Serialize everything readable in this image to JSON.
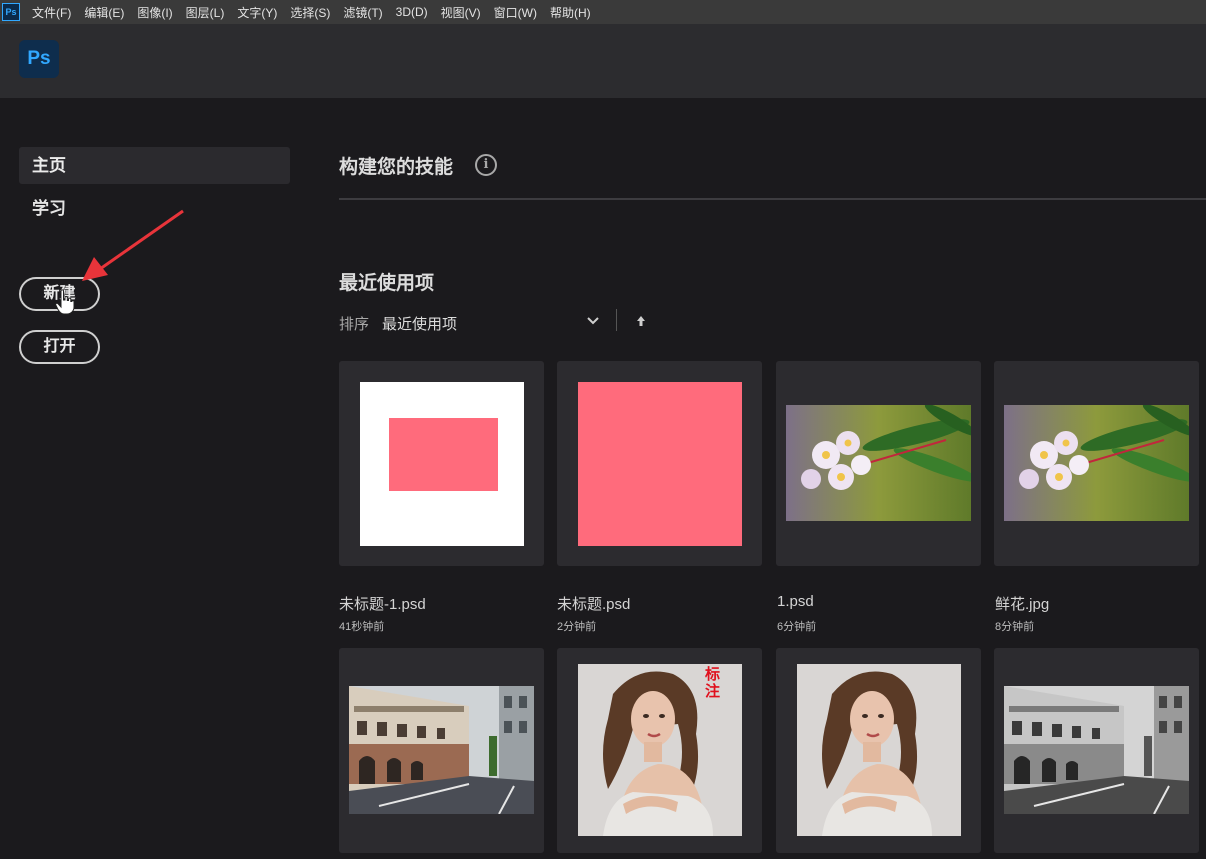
{
  "menu": [
    "文件(F)",
    "编辑(E)",
    "图像(I)",
    "图层(L)",
    "文字(Y)",
    "选择(S)",
    "滤镜(T)",
    "3D(D)",
    "视图(V)",
    "窗口(W)",
    "帮助(H)"
  ],
  "app": {
    "menu_icon": "Ps",
    "logo": "Ps",
    "brand_color": "#31a8ff"
  },
  "sidebar": {
    "home": "主页",
    "learn": "学习",
    "new_button": "新建",
    "open_button": "打开"
  },
  "main": {
    "skills_title": "构建您的技能",
    "info_icon": "i",
    "recent_title": "最近使用项",
    "sort_label": "排序",
    "sort_value": "最近使用项"
  },
  "files": [
    {
      "name": "未标题-1.psd",
      "time": "41秒钟前",
      "thumb": "white-with-pink-rect"
    },
    {
      "name": "未标题.psd",
      "time": "2分钟前",
      "thumb": "solid-pink"
    },
    {
      "name": "1.psd",
      "time": "6分钟前",
      "thumb": "flowers"
    },
    {
      "name": "鲜花.jpg",
      "time": "8分钟前",
      "thumb": "flowers"
    },
    {
      "thumb": "street-color"
    },
    {
      "thumb": "portrait",
      "stamp": "标注"
    },
    {
      "thumb": "portrait"
    },
    {
      "thumb": "street-gray"
    }
  ],
  "colors": {
    "accent_pink": "#ff6b7c",
    "annotation_red": "#e8343a",
    "stamp_red": "#e0101d"
  }
}
